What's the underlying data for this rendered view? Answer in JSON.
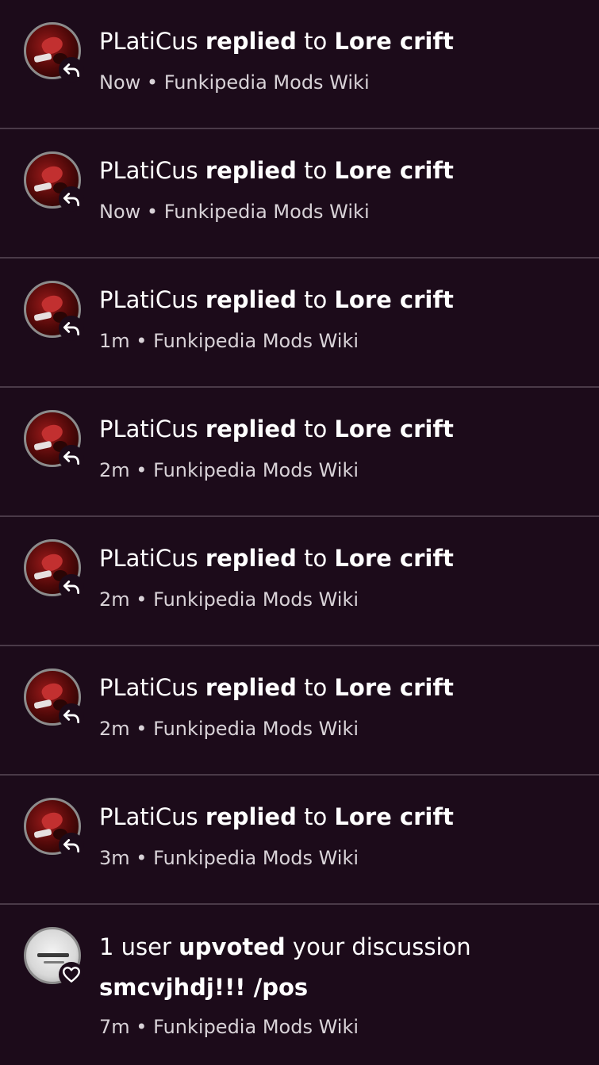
{
  "notifications": [
    {
      "actor": "PLatiCus",
      "action": "replied",
      "connector": "to",
      "target": "Lore crift",
      "time": "Now",
      "separator": "•",
      "wiki": "Funkipedia Mods Wiki",
      "icon": "reply-icon"
    },
    {
      "actor": "PLatiCus",
      "action": "replied",
      "connector": "to",
      "target": "Lore crift",
      "time": "Now",
      "separator": "•",
      "wiki": "Funkipedia Mods Wiki",
      "icon": "reply-icon"
    },
    {
      "actor": "PLatiCus",
      "action": "replied",
      "connector": "to",
      "target": "Lore crift",
      "time": "1m",
      "separator": "•",
      "wiki": "Funkipedia Mods Wiki",
      "icon": "reply-icon"
    },
    {
      "actor": "PLatiCus",
      "action": "replied",
      "connector": "to",
      "target": "Lore crift",
      "time": "2m",
      "separator": "•",
      "wiki": "Funkipedia Mods Wiki",
      "icon": "reply-icon"
    },
    {
      "actor": "PLatiCus",
      "action": "replied",
      "connector": "to",
      "target": "Lore crift",
      "time": "2m",
      "separator": "•",
      "wiki": "Funkipedia Mods Wiki",
      "icon": "reply-icon"
    },
    {
      "actor": "PLatiCus",
      "action": "replied",
      "connector": "to",
      "target": "Lore crift",
      "time": "2m",
      "separator": "•",
      "wiki": "Funkipedia Mods Wiki",
      "icon": "reply-icon"
    },
    {
      "actor": "PLatiCus",
      "action": "replied",
      "connector": "to",
      "target": "Lore crift",
      "time": "3m",
      "separator": "•",
      "wiki": "Funkipedia Mods Wiki",
      "icon": "reply-icon"
    }
  ],
  "upvote": {
    "actor": "1 user",
    "action": "upvoted",
    "connector": "your discussion",
    "target": "smcvjhdj!!! /pos",
    "time": "7m",
    "separator": "•",
    "wiki": "Funkipedia Mods Wiki",
    "icon": "heart-icon"
  },
  "colors": {
    "background": "#1c0b1a",
    "divider": "#4a3a48",
    "text": "#ffffff",
    "meta_text": "#d8d2d7"
  }
}
